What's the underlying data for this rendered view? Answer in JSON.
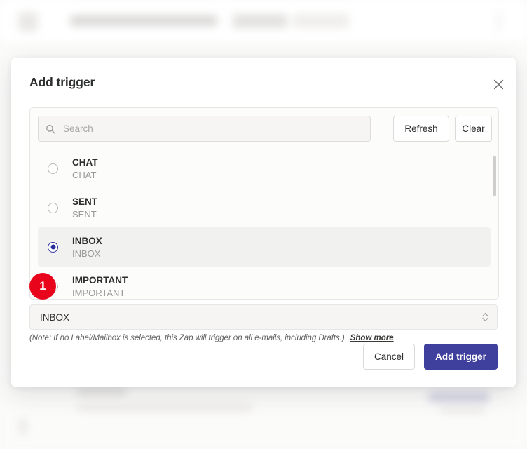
{
  "modal": {
    "title": "Add trigger",
    "close_icon": "close-icon",
    "search": {
      "placeholder": "Search",
      "value": "",
      "icon": "search-icon"
    },
    "buttons": {
      "refresh": "Refresh",
      "clear": "Clear",
      "cancel": "Cancel",
      "submit": "Add trigger"
    },
    "options": [
      {
        "label": "CHAT",
        "sub": "CHAT",
        "selected": false
      },
      {
        "label": "SENT",
        "sub": "SENT",
        "selected": false
      },
      {
        "label": "INBOX",
        "sub": "INBOX",
        "selected": true
      },
      {
        "label": "IMPORTANT",
        "sub": "IMPORTANT",
        "selected": false
      }
    ],
    "select": {
      "value": "INBOX",
      "icon": "chevron-updown-icon"
    },
    "note": {
      "text": "(Note: If no Label/Mailbox is selected, this Zap will trigger on all e-mails, including Drafts.)",
      "link": "Show more"
    }
  },
  "annotation": {
    "step_number": "1",
    "color": "#e8051c"
  },
  "colors": {
    "primary": "#3f3f9e",
    "radio_selected": "#2b2f9e",
    "row_highlight": "#f1f1f0",
    "panel_bg": "#fcfcfb",
    "border": "#e7e6e4"
  }
}
